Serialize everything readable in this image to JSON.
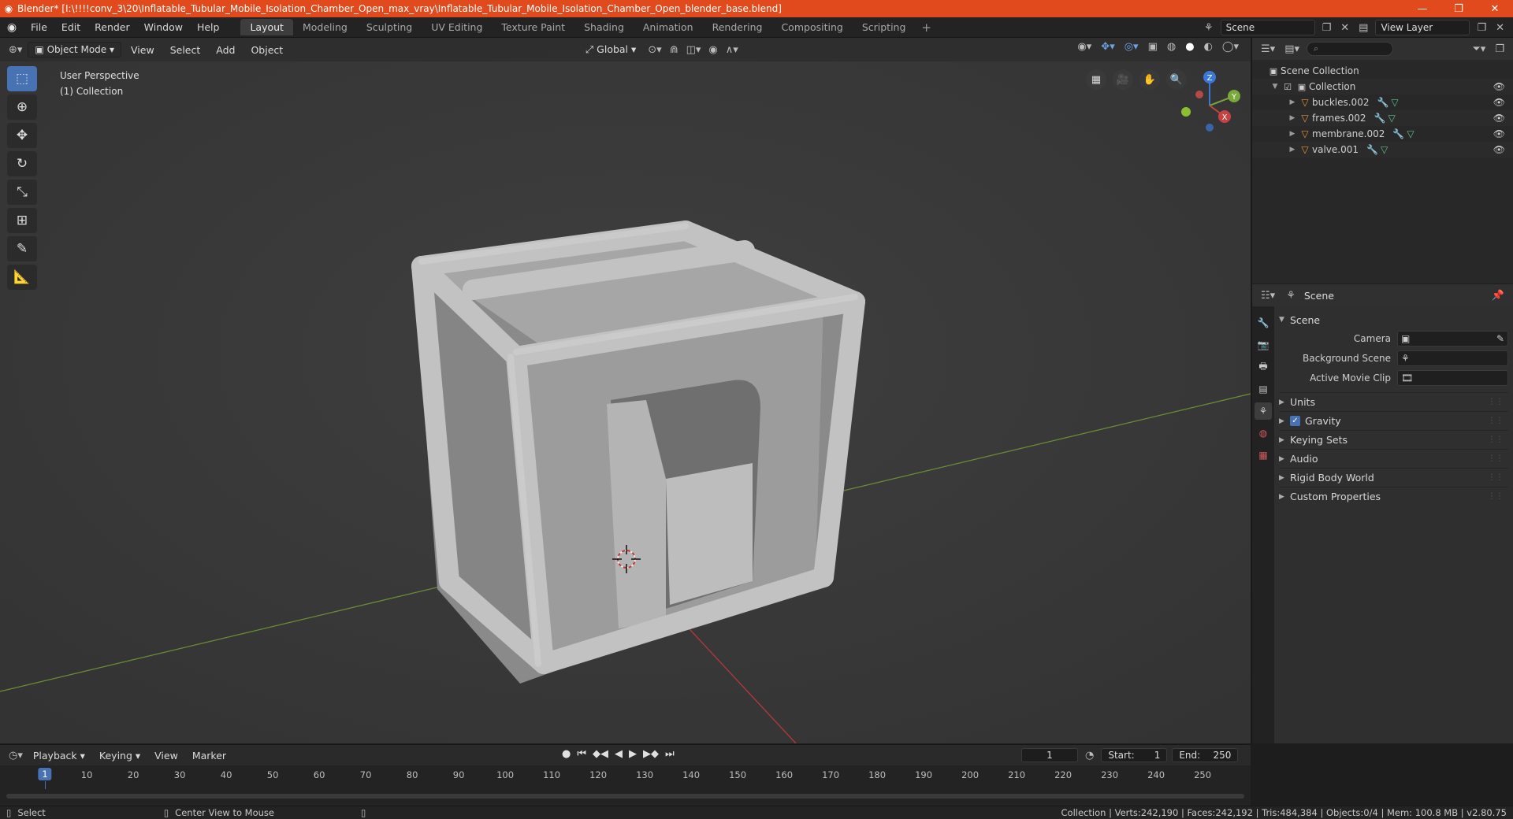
{
  "window": {
    "title": "Blender* [I:\\!!!!conv_3\\20\\Inflatable_Tubular_Mobile_Isolation_Chamber_Open_max_vray\\Inflatable_Tubular_Mobile_Isolation_Chamber_Open_blender_base.blend]",
    "minimize": "—",
    "maximize": "❐",
    "close": "✕"
  },
  "menu": [
    "File",
    "Edit",
    "Render",
    "Window",
    "Help"
  ],
  "workspaces": [
    "Layout",
    "Modeling",
    "Sculpting",
    "UV Editing",
    "Texture Paint",
    "Shading",
    "Animation",
    "Rendering",
    "Compositing",
    "Scripting"
  ],
  "active_workspace": "Layout",
  "scene_field": "Scene",
  "view_layer_field": "View Layer",
  "viewport": {
    "mode": "Object Mode",
    "menus": [
      "View",
      "Select",
      "Add",
      "Object"
    ],
    "orientation": "Global",
    "info_line1": "User Perspective",
    "info_line2": "(1) Collection",
    "gizmo": {
      "x": "X",
      "y": "Y",
      "z": "Z"
    }
  },
  "outliner": {
    "root": "Scene Collection",
    "collection": "Collection",
    "objects": [
      "buckles.002",
      "frames.002",
      "membrane.002",
      "valve.001"
    ]
  },
  "properties": {
    "header": "Scene",
    "panel": "Scene",
    "camera_label": "Camera",
    "background_label": "Background Scene",
    "movieclip_label": "Active Movie Clip",
    "sections": [
      "Units",
      "Gravity",
      "Keying Sets",
      "Audio",
      "Rigid Body World",
      "Custom Properties"
    ],
    "gravity_checked": true
  },
  "timeline": {
    "menus": [
      "Playback",
      "Keying",
      "View",
      "Marker"
    ],
    "current_frame": "1",
    "start_label": "Start:",
    "start": "1",
    "end_label": "End:",
    "end": "250",
    "ticks": [
      "10",
      "20",
      "30",
      "40",
      "50",
      "60",
      "70",
      "80",
      "90",
      "100",
      "110",
      "120",
      "130",
      "140",
      "150",
      "160",
      "170",
      "180",
      "190",
      "200",
      "210",
      "220",
      "230",
      "240",
      "250"
    ]
  },
  "status": {
    "left": "Select",
    "middle": "Center View to Mouse",
    "right": "Collection | Verts:242,190 | Faces:242,192 | Tris:484,384 | Objects:0/4 | Mem: 100.8 MB | v2.80.75"
  },
  "colors": {
    "titlebar": "#e04a1c",
    "accent": "#4772b3",
    "viewport_bg": "#393939",
    "axis_x": "#c64242",
    "axis_y": "#7aa83a"
  }
}
